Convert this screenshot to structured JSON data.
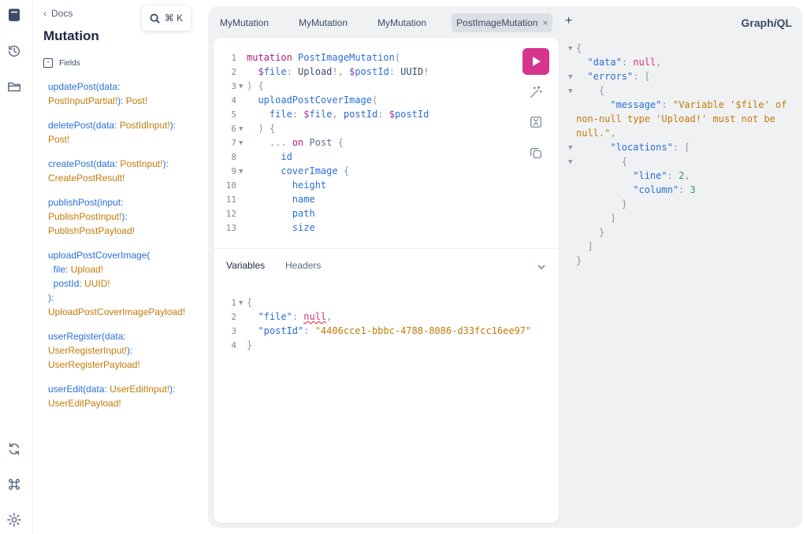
{
  "sidebar": {
    "icons": [
      "docs-icon",
      "history-icon",
      "folder-icon",
      "refresh-icon",
      "command-icon",
      "settings-icon"
    ]
  },
  "docs": {
    "back_label": "Docs",
    "title": "Mutation",
    "fields_label": "Fields",
    "search_shortcut": "⌘ K",
    "fields": [
      {
        "name": "updatePost",
        "args": [
          {
            "name": "data",
            "type": "PostInputPartial!"
          }
        ],
        "returns": "Post!"
      },
      {
        "name": "deletePost",
        "args": [
          {
            "name": "data",
            "type": "PostIdInput!"
          }
        ],
        "returns": "Post!"
      },
      {
        "name": "createPost",
        "args": [
          {
            "name": "data",
            "type": "PostInput!"
          }
        ],
        "returns": "CreatePostResult!"
      },
      {
        "name": "publishPost",
        "args": [
          {
            "name": "input",
            "type": "PublishPostInput!"
          }
        ],
        "returns": "PublishPostPayload!"
      },
      {
        "name": "uploadPostCoverImage",
        "args": [
          {
            "name": "file",
            "type": "Upload!"
          },
          {
            "name": "postId",
            "type": "UUID!"
          }
        ],
        "returns": "UploadPostCoverImagePayload!"
      },
      {
        "name": "userRegister",
        "args": [
          {
            "name": "data",
            "type": "UserRegisterInput!"
          }
        ],
        "returns": "UserRegisterPayload!"
      },
      {
        "name": "userEdit",
        "args": [
          {
            "name": "data",
            "type": "UserEditInput!"
          }
        ],
        "returns": "UserEditPayload!"
      }
    ]
  },
  "tabs": [
    {
      "label": "MyMutation",
      "active": false
    },
    {
      "label": "MyMutation",
      "active": false
    },
    {
      "label": "MyMutation",
      "active": false
    },
    {
      "label": "PostImageMutation",
      "active": true
    }
  ],
  "add_tab": "+",
  "close_tab": "×",
  "brand": {
    "prefix": "Graph",
    "suffix": "i",
    "end": "QL"
  },
  "query_lines": [
    "mutation PostImageMutation(",
    "  $file: Upload!, $postId: UUID!",
    ") {",
    "  uploadPostCoverImage(",
    "    file: $file, postId: $postId",
    "  ) {",
    "    ... on Post {",
    "      id",
    "      coverImage {",
    "        height",
    "        name",
    "        path",
    "        size"
  ],
  "line_numbers": [
    "1",
    "2",
    "3",
    "4",
    "5",
    "6",
    "7",
    "8",
    "9",
    "10",
    "11",
    "12",
    "13"
  ],
  "bottom_tabs": {
    "variables": "Variables",
    "headers": "Headers"
  },
  "variables": {
    "line_numbers": [
      "1",
      "2",
      "3",
      "4"
    ],
    "file_key": "\"file\"",
    "file_value": "null",
    "postId_key": "\"postId\"",
    "postId_value": "\"4406cce1-bbbc-4788-8086-d33fcc16ee97\""
  },
  "result": {
    "data_key": "\"data\"",
    "data_value": "null",
    "errors_key": "\"errors\"",
    "message_key": "\"message\"",
    "message_part1": "\"Variable '$file' of",
    "message_part2": "non-null type 'Upload!' must not be",
    "message_part3": "null.\"",
    "locations_key": "\"locations\"",
    "line_key": "\"line\"",
    "line_value": "2",
    "column_key": "\"column\"",
    "column_value": "3"
  },
  "colors": {
    "run_button": "#d6358d",
    "keyword": "#b11b80",
    "string": "#c27b09",
    "field": "#2a6fd6"
  }
}
